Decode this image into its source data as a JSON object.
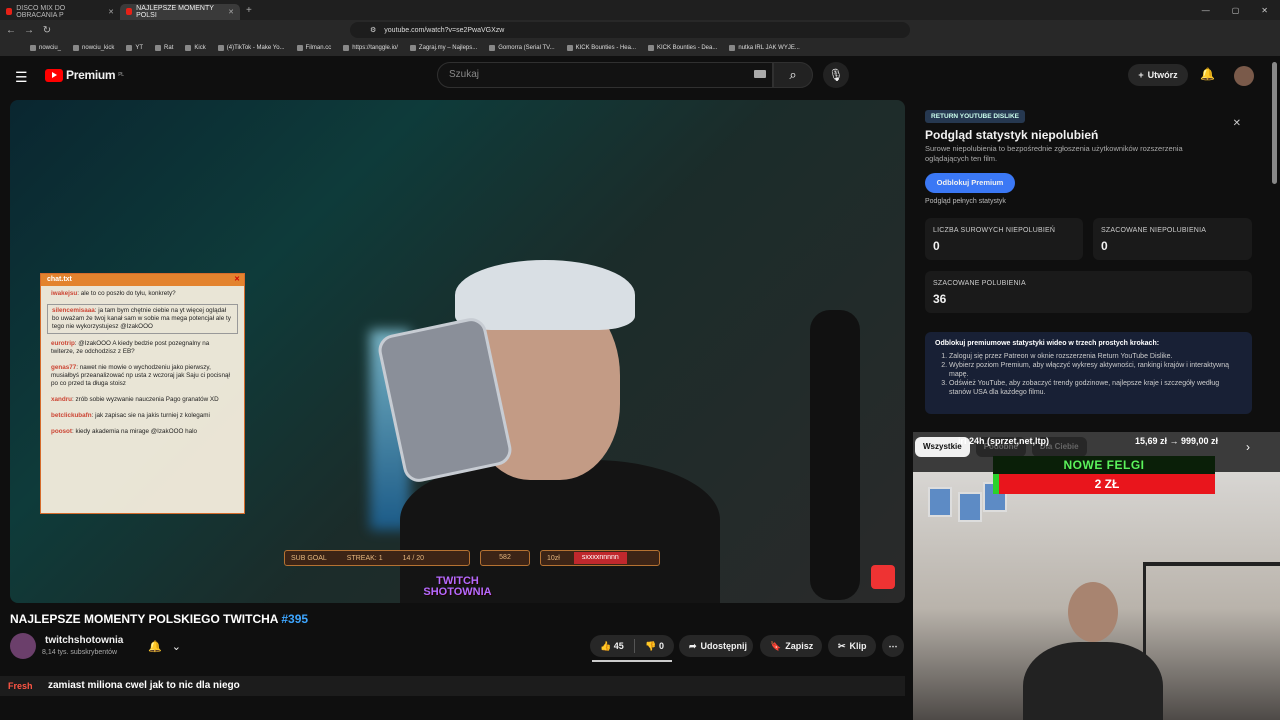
{
  "browser": {
    "tabs": [
      {
        "label": "DISCO MIX DO OBRACANIA P",
        "active": false
      },
      {
        "label": "NAJLEPSZE MOMENTY POLSI",
        "active": true
      }
    ],
    "url": "youtube.com/watch?v=se2PwaVGXzw",
    "bookmarks": [
      "nowciu_",
      "nowciu_kick",
      "YT",
      "Rat",
      "Kick",
      "(4)TikTok - Make Yo...",
      "Filman.cc",
      "https://tanggle.io/",
      "Zagraj.my – Najleps...",
      "Gomorra (Serial TV...",
      "KICK Bounties - Hea...",
      "KICK Bounties - Dea...",
      "nutka IRL JAK WYJE..."
    ]
  },
  "header": {
    "logo_text": "Premium",
    "logo_region": "PL",
    "search_placeholder": "Szukaj",
    "create_label": "Utwórz"
  },
  "video": {
    "chat_title": "chat.txt",
    "chat_messages": [
      {
        "user": "iwakejsu",
        "text": "ale to co poszło do tyłu, konkrety?",
        "highlight": false
      },
      {
        "user": "silencemisaaa",
        "text": "ja tam bym chętnie ciebie na yt więcej oglądał bo uważam że twoj kanał sam w sobie ma mega potencjał ale ty tego nie wykorzystujesz @IzakOOO",
        "highlight": true
      },
      {
        "user": "eurotrip",
        "text": "@IzakOOO A kiedy bedzie post pozegnalny na twiterze, ze odchodzisz z EB?",
        "highlight": false
      },
      {
        "user": "genas77",
        "text": "nawet nie mowie o wychodzeniu jako pierwszy, musiałbyś przeanalizować np usta z wczoraj jak Saju ci pocisnął po co przed ta długa stoisz",
        "highlight": false
      },
      {
        "user": "xandru",
        "text": "zrób sobie wyzwanie nauczenia Pago granatów XD",
        "highlight": false
      },
      {
        "user": "betclickubafn",
        "text": "jak zapisac sie na jakis turniej z kolegami",
        "highlight": false
      },
      {
        "user": "poosot",
        "text": "kiedy akademia na mirage @IzakOOO halo",
        "highlight": false
      }
    ],
    "subgoal_label": "SUB GOAL",
    "streak_label": "STREAK: 1",
    "subgoal_progress": "14 / 20",
    "sub_count": "582",
    "tip_amount": "10zł",
    "tip_name": "sxxxxnnnnn",
    "watermark": "TWITCH SHOTOWNIA"
  },
  "meta": {
    "title": "NAJLEPSZE MOMENTY POLSKIEGO TWITCHA",
    "title_hash": "#395",
    "channel": "twitchshotownia",
    "subscribers": "8,14 tys. subskrybentów",
    "likes": "45",
    "dislikes": "0",
    "share_label": "Udostępnij",
    "save_label": "Zapisz",
    "clip_label": "Klip",
    "desc_prefix": "Fresh",
    "desc_text": "zamiast miliona cwel jak to nic dla niego"
  },
  "rypd": {
    "tag": "RETURN YOUTUBE DISLIKE",
    "title": "Podgląd statystyk niepolubień",
    "description": "Surowe niepolubienia to bezpośrednie zgłoszenia użytkowników rozszerzenia oglądających ten film.",
    "unlock_label": "Odblokuj Premium",
    "preview_full": "Podgląd pełnych statystyk",
    "stats": [
      {
        "label": "LICZBA SUROWYCH NIEPOLUBIEŃ",
        "value": "0"
      },
      {
        "label": "SZACOWANE NIEPOLUBIENIA",
        "value": "0"
      },
      {
        "label": "SZACOWANE POLUBIENIA",
        "value": "36"
      }
    ],
    "steps_header": "Odblokuj premiumowe statystyki wideo w trzech prostych krokach:",
    "steps": [
      "Zaloguj się przez Patreon w oknie rozszerzenia Return YouTube Dislike.",
      "Wybierz poziom Premium, aby włączyć wykresy aktywności, rankingi krajów i interaktywną mapę.",
      "Odśwież YouTube, aby zobaczyć trendy godzinowe, najlepsze kraje i szczegóły według stanów USA dla każdego filmu."
    ]
  },
  "pip": {
    "chip_first": "Wszystkie",
    "chip_rest": [
      "Podobne",
      "Dla Ciebie"
    ],
    "top_left": "irl 24h (sprzet,net,ltp)",
    "top_right": "15,69 zł → 999,00 zł",
    "banner": "NOWE FELGI",
    "banner_value": "2 ZŁ"
  }
}
